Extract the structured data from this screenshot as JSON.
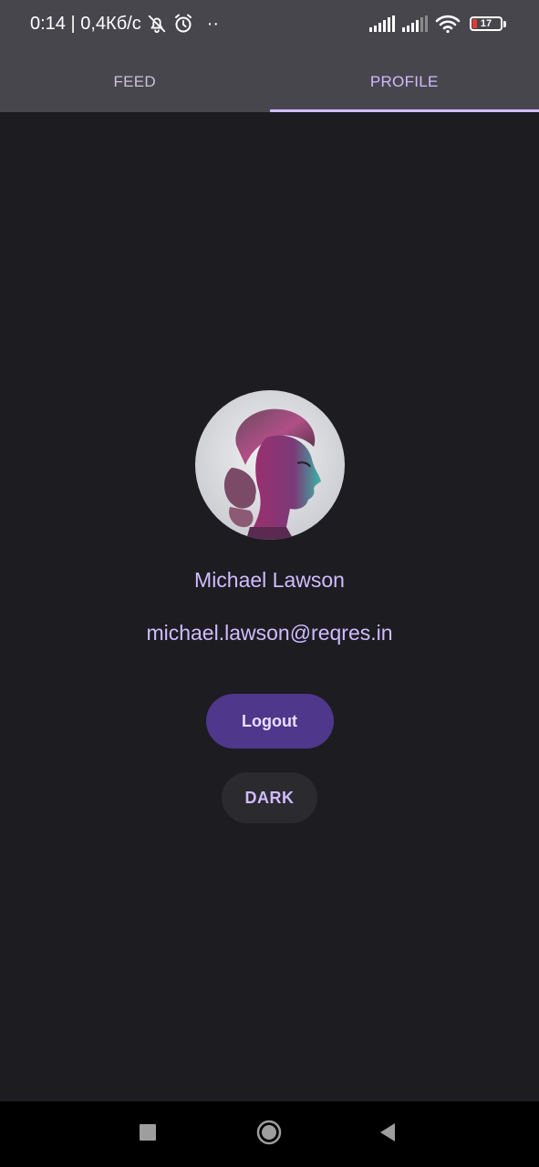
{
  "status_bar": {
    "time_speed": "0:14 | 0,4Кб/с",
    "more_indicator": "··",
    "battery_level": 17,
    "battery_label": "17",
    "icons": [
      "bell-off-icon",
      "alarm-icon",
      "signal-icon",
      "signal-icon",
      "wifi-icon",
      "battery-icon"
    ]
  },
  "tabs": [
    {
      "label": "FEED",
      "active": false
    },
    {
      "label": "PROFILE",
      "active": true
    }
  ],
  "profile": {
    "name": "Michael Lawson",
    "email": "michael.lawson@reqres.in",
    "avatar_icon": "profile-photo"
  },
  "buttons": {
    "logout_label": "Logout",
    "theme_label": "DARK"
  },
  "nav_bar": {
    "icons": [
      "recents-square-icon",
      "home-circle-icon",
      "back-triangle-icon"
    ]
  },
  "colors": {
    "background": "#1d1c21",
    "header": "#48464d",
    "accent": "#d0bcff",
    "primary_container": "#4f378b",
    "battery_low": "#e53935"
  }
}
